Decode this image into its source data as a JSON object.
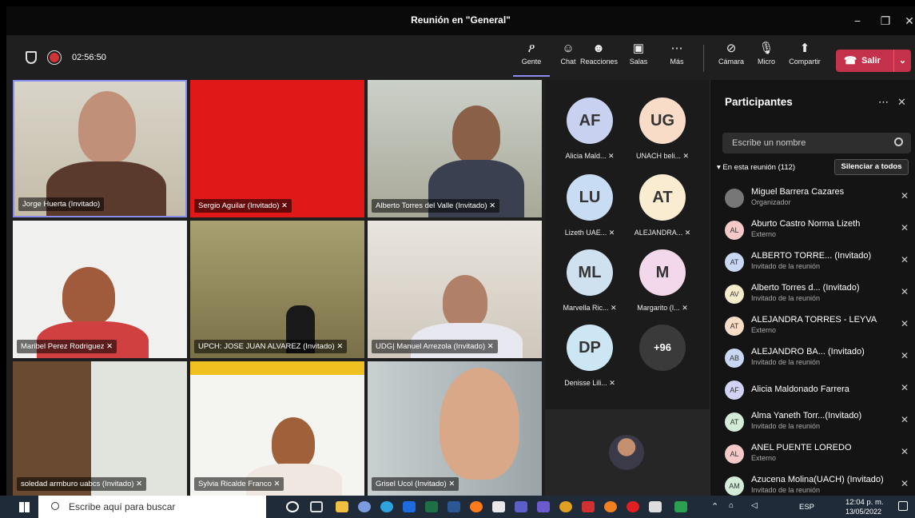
{
  "window": {
    "title": "Reunión en \"General\"",
    "min": "−",
    "max": "❐",
    "close": "✕"
  },
  "meeting": {
    "timer": "02:56:50"
  },
  "toolbar": {
    "items": [
      {
        "label": "Gente",
        "icon": "ዖ"
      },
      {
        "label": "Chat",
        "icon": "☺"
      },
      {
        "label": "Reacciones",
        "icon": "☻"
      },
      {
        "label": "Salas",
        "icon": "▣"
      },
      {
        "label": "Más",
        "icon": "⋯"
      }
    ],
    "controls": [
      {
        "label": "Cámara",
        "icon": "⊘"
      },
      {
        "label": "Micro",
        "icon": "🎙"
      },
      {
        "label": "Compartir",
        "icon": "⬆"
      }
    ],
    "leave_label": "Salir",
    "leave_icon": "☎",
    "dropdown": "⌄"
  },
  "tiles": [
    {
      "label": "Jorge Huerta (Invitado)"
    },
    {
      "label": "Sergio Aguilar (Invitado) ✕"
    },
    {
      "label": "Alberto Torres del Valle (Invitado) ✕"
    },
    {
      "label": "Maribel Perez Rodriguez ✕"
    },
    {
      "label": "UPCH: JOSE JUAN ALVAREZ (Invitado) ✕"
    },
    {
      "label": "UDG| Manuel Arrezola (Invitado) ✕"
    },
    {
      "label": "soledad armburo uabcs (Invitado) ✕"
    },
    {
      "label": "Sylvia Ricalde Franco ✕"
    },
    {
      "label": "Grisel Ucol (Invitado) ✕"
    }
  ],
  "avatars": [
    {
      "initials": "AF",
      "name": "Alicia Mald... ✕",
      "color": "#c8d2f0"
    },
    {
      "initials": "UG",
      "name": "UNACH beli... ✕",
      "color": "#f8dcc8"
    },
    {
      "initials": "LU",
      "name": "Lizeth UAE... ✕",
      "color": "#c8dcf4"
    },
    {
      "initials": "AT",
      "name": "ALEJANDRA... ✕",
      "color": "#faecd0"
    },
    {
      "initials": "ML",
      "name": "Marvella Ric... ✕",
      "color": "#cfe0ef"
    },
    {
      "initials": "M",
      "name": "Margarito (I... ✕",
      "color": "#f2d8ea"
    },
    {
      "initials": "DP",
      "name": "Denisse Lili... ✕",
      "color": "#cde6f4"
    },
    {
      "initials": "+96",
      "name": "",
      "color": "#3a3a3a"
    }
  ],
  "participants": {
    "title": "Participantes",
    "more": "⋯",
    "close": "✕",
    "search_placeholder": "Escribe un nombre",
    "section": "En esta reunión (112)",
    "mute_all": "Silenciar a todos",
    "list": [
      {
        "initials": "",
        "name": "Miguel Barrera Cazares",
        "role": "Organizador",
        "color": "#777"
      },
      {
        "initials": "AL",
        "name": "Aburto Castro Norma Lizeth",
        "role": "Externo",
        "color": "#f6c8c8"
      },
      {
        "initials": "AT",
        "name": "ALBERTO TORRE... (Invitado)",
        "role": "Invitado de la reunión",
        "color": "#c8d8f4"
      },
      {
        "initials": "AV",
        "name": "Alberto Torres d... (Invitado)",
        "role": "Invitado de la reunión",
        "color": "#f6eccc"
      },
      {
        "initials": "AT",
        "name": "ALEJANDRA TORRES - LEYVA",
        "role": "Externo",
        "color": "#f8dcc8"
      },
      {
        "initials": "AB",
        "name": "ALEJANDRO BA... (Invitado)",
        "role": "Invitado de la reunión",
        "color": "#c8d8f4"
      },
      {
        "initials": "AF",
        "name": "Alicia Maldonado Farrera",
        "role": "",
        "color": "#d2d2f4"
      },
      {
        "initials": "AT",
        "name": "Alma Yaneth Torr...(Invitado)",
        "role": "Invitado de la reunión",
        "color": "#d2ecd8"
      },
      {
        "initials": "AL",
        "name": "ANEL PUENTE LOREDO",
        "role": "Externo",
        "color": "#f6c8c8"
      },
      {
        "initials": "AM",
        "name": "Azucena Molina(UACH) (Invitado)",
        "role": "Invitado de la reunión",
        "color": "#d2ecd8"
      }
    ]
  },
  "taskbar": {
    "search": "Escribe aquí para buscar",
    "lang": "ESP",
    "time": "12:04 p. m.",
    "date": "13/05/2022"
  }
}
